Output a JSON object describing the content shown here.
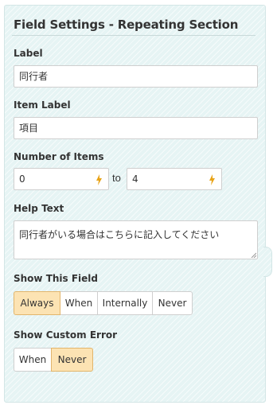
{
  "title": "Field Settings - Repeating Section",
  "label_field": {
    "label": "Label",
    "value": "同行者"
  },
  "item_label_field": {
    "label": "Item Label",
    "value": "項目"
  },
  "number_of_items": {
    "label": "Number of Items",
    "min": "0",
    "to": "to",
    "max": "4",
    "icon": "lightning-bolt-icon"
  },
  "help_text": {
    "label": "Help Text",
    "value": "同行者がいる場合はこちらに記入してください"
  },
  "show_this_field": {
    "label": "Show This Field",
    "options": [
      "Always",
      "When",
      "Internally",
      "Never"
    ],
    "selected": "Always"
  },
  "show_custom_error": {
    "label": "Show Custom Error",
    "options": [
      "When",
      "Never"
    ],
    "selected": "Never"
  },
  "colors": {
    "panel_bg": "#e6f4f4",
    "active_button": "#fce3b3",
    "bolt": "#e8a317"
  }
}
